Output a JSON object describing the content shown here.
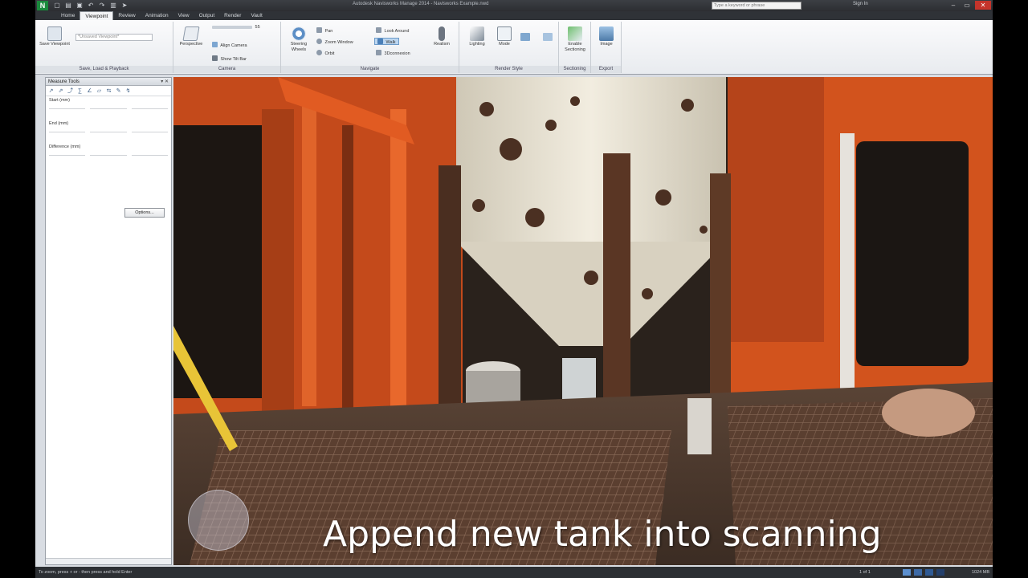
{
  "window": {
    "title": "Autodesk Navisworks Manage 2014 - Navisworks Example.nwd",
    "search_placeholder": "Type a keyword or phrase",
    "sign_in": "Sign In"
  },
  "tabs": [
    "Home",
    "Viewpoint",
    "Review",
    "Animation",
    "View",
    "Output",
    "Render",
    "Vault"
  ],
  "active_tab": "Viewpoint",
  "ribbon": {
    "save_viewpoint": "Save Viewpoint",
    "viewpoint_select": "*Unsaved Viewpoint*",
    "panel_save_load": "Save, Load & Playback",
    "perspective": "Perspective",
    "align_camera": "Align Camera",
    "show_tilt_bar": "Show Tilt Bar",
    "fov_value": "55",
    "panel_camera": "Camera",
    "steering_wheels": "Steering Wheels",
    "pan": "Pan",
    "zoom_window": "Zoom Window",
    "orbit": "Orbit",
    "look_around": "Look Around",
    "walk": "Walk",
    "connexion": "3Dconnexion",
    "realism": "Realism",
    "panel_navigate": "Navigate",
    "lighting": "Lighting",
    "mode": "Mode",
    "panel_render_style": "Render Style",
    "enable_sectioning": "Enable Sectioning",
    "panel_sectioning": "Sectioning",
    "image": "Image",
    "panel_export": "Export"
  },
  "measure_panel": {
    "title": "Measure Tools",
    "start": "Start (mm)",
    "end": "End (mm)",
    "difference": "Difference (mm)",
    "options_button": "Options..."
  },
  "viewport": {
    "caption": "Append new tank into scanning"
  },
  "status": {
    "hint": "To zoom, press + or - then press and hold Enter",
    "page": "1 of 1",
    "memory": "1024 MB"
  },
  "colors": {
    "accent": "#2b6cb0",
    "hull_orange": "#d9561f",
    "tank_white": "#e8e2d2",
    "rust": "#6b3a22"
  }
}
